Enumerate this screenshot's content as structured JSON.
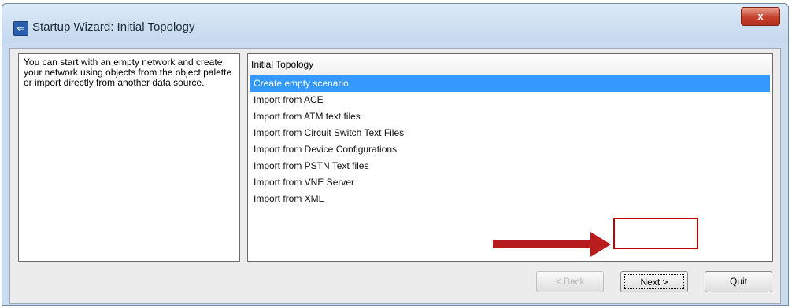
{
  "window": {
    "title": "Startup Wizard: Initial Topology",
    "close_glyph": "x",
    "app_icon": "wizard-arrow-icon"
  },
  "description": "You can start with an empty network and create your network using objects from the object palette or import directly from another data source.",
  "topology_list": {
    "header": "Initial Topology",
    "items": [
      {
        "label": "Create empty scenario",
        "selected": true
      },
      {
        "label": "Import from ACE",
        "selected": false
      },
      {
        "label": "Import from ATM text files",
        "selected": false
      },
      {
        "label": "Import from Circuit Switch Text Files",
        "selected": false
      },
      {
        "label": "Import from Device Configurations",
        "selected": false
      },
      {
        "label": "Import from PSTN Text files",
        "selected": false
      },
      {
        "label": "Import from VNE Server",
        "selected": false
      },
      {
        "label": "Import from XML",
        "selected": false
      }
    ]
  },
  "buttons": {
    "back": "< Back",
    "next": "Next >",
    "quit": "Quit"
  },
  "colors": {
    "selection": "#3399ff",
    "annotation": "#c00000"
  }
}
